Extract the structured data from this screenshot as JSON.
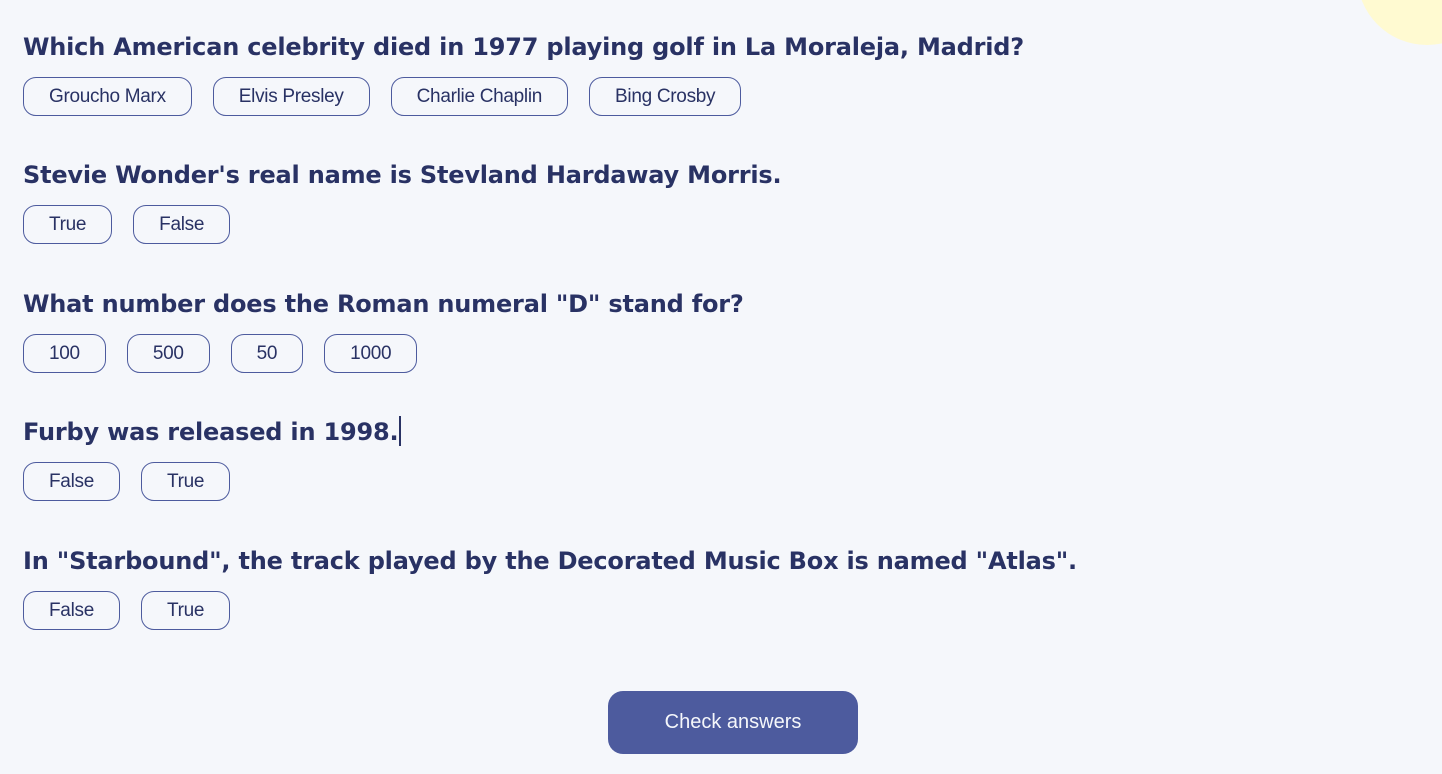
{
  "questions": [
    {
      "text": "Which American celebrity died in 1977 playing golf in La Moraleja, Madrid?",
      "answers": [
        "Groucho Marx",
        "Elvis Presley",
        "Charlie Chaplin",
        "Bing Crosby"
      ]
    },
    {
      "text": "Stevie Wonder's real name is Stevland Hardaway Morris.",
      "answers": [
        "True",
        "False"
      ]
    },
    {
      "text": "What number does the Roman numeral \"D\" stand for?",
      "answers": [
        "100",
        "500",
        "50",
        "1000"
      ]
    },
    {
      "text": "Furby was released in 1998.",
      "answers": [
        "False",
        "True"
      ]
    },
    {
      "text": "In \"Starbound\", the track played by the Decorated Music Box is named \"Atlas\".",
      "answers": [
        "False",
        "True"
      ]
    }
  ],
  "check_button": {
    "label": "Check answers"
  },
  "colors": {
    "background": "#f5f7fb",
    "text": "#293264",
    "accent": "#4d5b9e",
    "blob": "#fffad1"
  }
}
